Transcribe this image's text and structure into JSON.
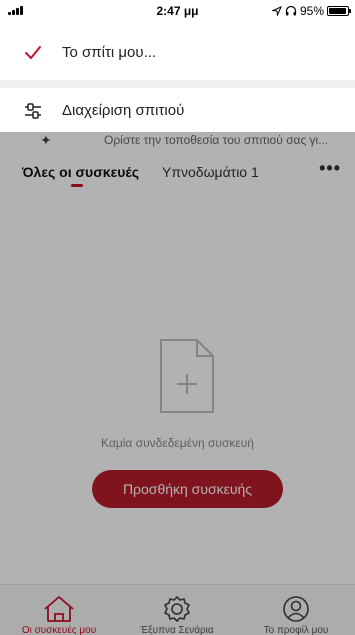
{
  "status_bar": {
    "time": "2:47 μμ",
    "battery": "95%",
    "battery_level": 0.95
  },
  "dropdown": {
    "items": [
      {
        "label": "Το σπίτι μου...",
        "icon": "checkmark-icon",
        "selected": true
      },
      {
        "label": "Διαχείριση σπιτιού",
        "icon": "sliders-icon"
      }
    ]
  },
  "home_hint": {
    "text": "Ορίστε την τοποθεσία του σπιτιού σας γι..."
  },
  "tabs": {
    "all_devices": "Όλες οι συσκευές",
    "subroom": "Υπνοδωμάτιο 1",
    "more": "•••"
  },
  "empty_state": {
    "message": "Καμία συνδεδεμένη συσκευή",
    "button_label": "Προσθήκη συσκευής"
  },
  "bottom_nav": {
    "items": [
      {
        "label": "Οι συσκευές μου",
        "icon": "home-icon",
        "active": true
      },
      {
        "label": "Έξυπνα Σενάρια",
        "icon": "settings-icon"
      },
      {
        "label": "Το προφίλ μου",
        "icon": "profile-icon"
      }
    ]
  },
  "colors": {
    "accent": "#c8102e",
    "button": "#b71c2b"
  }
}
